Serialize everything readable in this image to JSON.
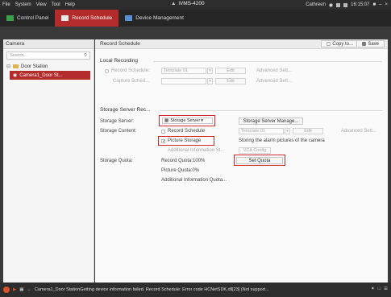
{
  "menubar": {
    "items": [
      "File",
      "System",
      "View",
      "Tool",
      "Help"
    ],
    "app_title": "iVMS-4200",
    "user": "Cathreen",
    "time": "16:15:07"
  },
  "tabs": [
    {
      "label": "Control Panel"
    },
    {
      "label": "Record Schedule"
    },
    {
      "label": "Device Management"
    }
  ],
  "camera_panel": {
    "title": "Camera",
    "search_placeholder": "Search...",
    "tree": {
      "station": "Door Station",
      "camera": "Camera1_Door St..."
    }
  },
  "record_schedule": {
    "title": "Record Schedule",
    "copy_label": "Copy to...",
    "save_label": "Save",
    "local_recording": "Local Recording",
    "record_schedule_label": "Record Schedule:",
    "template_value": "Template 01",
    "edit_label": "Edit",
    "advanced_label": "Advanced Sett...",
    "capture_schedule_label": "Capture Sched..."
  },
  "storage_server_rec": {
    "title": "Storage Server Rec...",
    "server_label": "Storage Server:",
    "server_value": "Storage Server",
    "server_manage_button": "Storage Server Manage...",
    "content_label": "Storage Content:",
    "record_schedule_option": "Record Schedule",
    "template_value": "Template 01",
    "edit_label": "Edit",
    "advanced_label": "Advanced Sett...",
    "picture_storage_option": "Picture Storage",
    "picture_storage_desc": "Storing the alarm pictures of the camera",
    "additional_info": "Additional Information St...",
    "vca_config": "VCA Config",
    "quota_label": "Storage Quota:",
    "set_quota_button": "Set Quota",
    "record_quota": "Record Quota:100%",
    "picture_quota": "Picture Quota:0%",
    "additional_quota": "Additional Information Quota..."
  },
  "statusbar": {
    "message": "Camera1_Door StationGetting device information failed. Record Schedule: Error code HCNetSDK.dll[23] (Not support..."
  },
  "colors": {
    "accent": "#b32b2b",
    "highlight": "#d6262e"
  }
}
